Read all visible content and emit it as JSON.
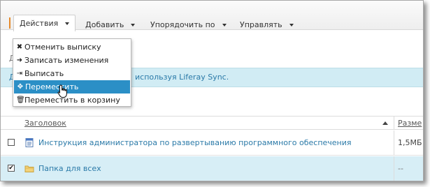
{
  "toolbar": {
    "actions_label": "Действия",
    "add_label": "Добавить",
    "sort_label": "Упорядочить по",
    "manage_label": "Управлять"
  },
  "breadcrumb": {
    "lead": "Д"
  },
  "banner": {
    "lead": "Д",
    "link_text": "используя Liferay Sync."
  },
  "menu": {
    "items": [
      {
        "label": "Отменить выписку",
        "icon": "close-icon"
      },
      {
        "label": "Записать изменения",
        "icon": "sign-in-icon"
      },
      {
        "label": "Выписать",
        "icon": "sign-out-icon"
      },
      {
        "label": "Переместить",
        "icon": "move-icon"
      },
      {
        "label": "Переместить в корзину",
        "icon": "trash-icon"
      }
    ]
  },
  "table": {
    "headers": {
      "title": "Заголовок",
      "size": "Разме"
    },
    "rows": [
      {
        "title": "Инструкция администратора по развертыванию программного обеспечения",
        "size": "1,5МБ",
        "checked": false,
        "icon": "document-icon"
      },
      {
        "title": "Папка для всех",
        "size": "--",
        "checked": true,
        "icon": "folder-icon"
      }
    ]
  },
  "colors": {
    "accent": "#2b8fc6",
    "link": "#2b7aa8",
    "banner_bg": "#d1ecf4",
    "selected_row": "#d7eef6"
  }
}
